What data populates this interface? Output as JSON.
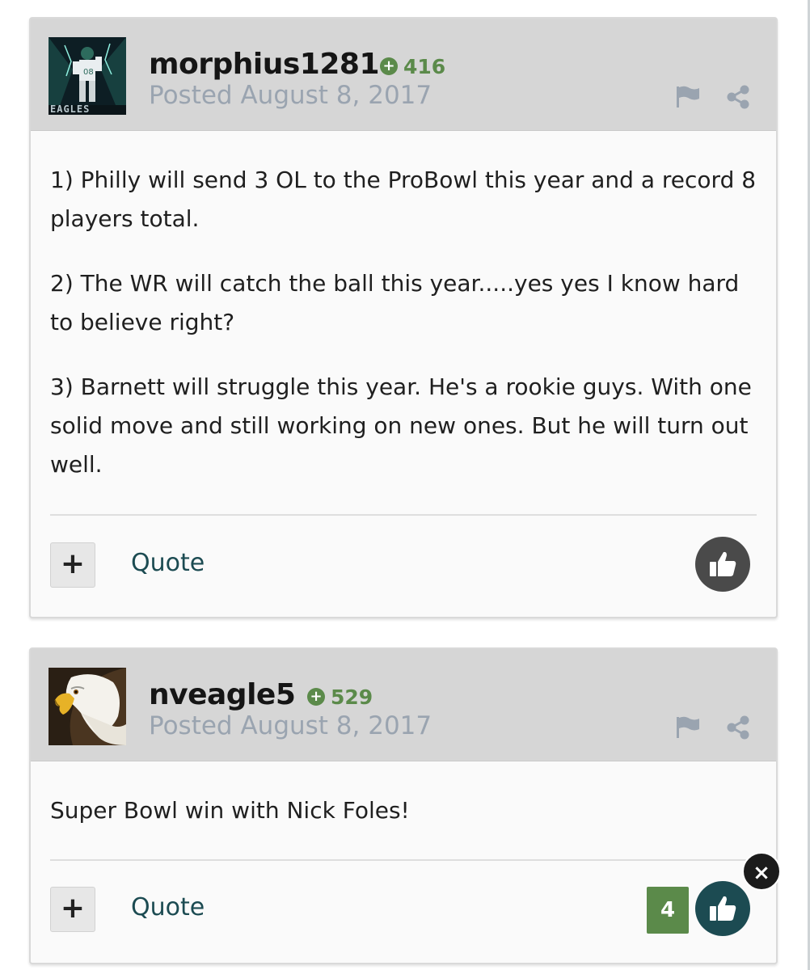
{
  "posts": [
    {
      "username": "morphius1281",
      "reputation": "416",
      "posted": "Posted August 8, 2017",
      "avatar_label": "EAGLES",
      "paragraphs": [
        "1) Philly will send 3 OL to the ProBowl this year and a record  8 players total.",
        "2) The WR will catch the ball this year.....yes yes I know hard to believe right?",
        "3) Barnett will struggle this year. He's a rookie guys. With one solid move and still working on new ones. But he will turn out well."
      ],
      "quote_label": "Quote",
      "plus_label": "+",
      "like_button_color": "#4a4a4a"
    },
    {
      "username": "nveagle5",
      "reputation": "529",
      "posted": "Posted August 8, 2017",
      "paragraphs": [
        "Super Bowl win with Nick Foles!"
      ],
      "quote_label": "Quote",
      "plus_label": "+",
      "like_count": "4",
      "like_button_color": "#1c4b52"
    }
  ],
  "close_label": "×",
  "colors": {
    "header_bg": "#d6d6d6",
    "reputation_green": "#5b8a4a",
    "posted_gray": "#9aa4b0",
    "quote_teal": "#1c4b52"
  },
  "icons": [
    "plus-circle-icon",
    "flag-icon",
    "share-icon",
    "thumbs-up-icon",
    "close-icon"
  ]
}
